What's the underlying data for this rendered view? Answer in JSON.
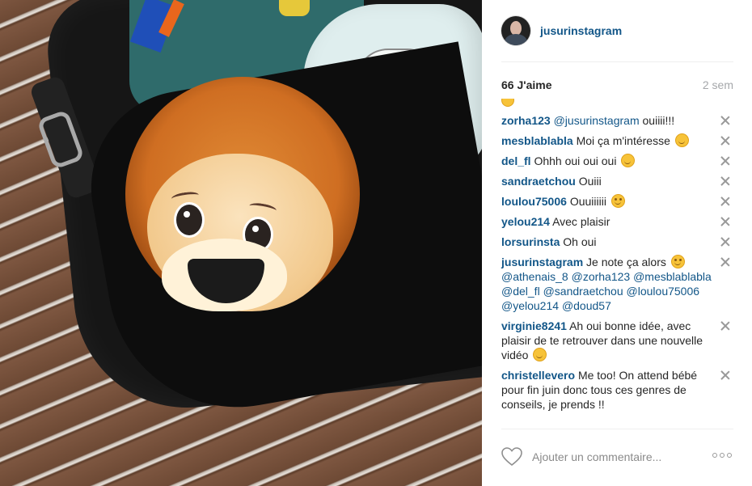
{
  "post": {
    "author": "jusurinstagram",
    "likes": "66 J'aime",
    "time": "2 sem"
  },
  "comments": [
    {
      "user": "zorha123",
      "text": "@jusurinstagram ouiiii!!!",
      "parts": [
        {
          "t": "mention",
          "v": "@jusurinstagram"
        },
        {
          "t": "text",
          "v": " ouiiii!!!"
        }
      ]
    },
    {
      "user": "mesblablabla",
      "parts": [
        {
          "t": "text",
          "v": "Moi ça m'intéresse "
        },
        {
          "t": "emoji",
          "v": "smile"
        }
      ]
    },
    {
      "user": "del_fl",
      "parts": [
        {
          "t": "text",
          "v": "Ohhh oui oui oui "
        },
        {
          "t": "emoji",
          "v": "grin"
        }
      ]
    },
    {
      "user": "sandraetchou",
      "parts": [
        {
          "t": "text",
          "v": "Ouiii"
        }
      ]
    },
    {
      "user": "loulou75006",
      "parts": [
        {
          "t": "text",
          "v": "Ouuiiiiii "
        },
        {
          "t": "emoji",
          "v": "wink"
        }
      ]
    },
    {
      "user": "yelou214",
      "parts": [
        {
          "t": "text",
          "v": "Avec plaisir"
        }
      ]
    },
    {
      "user": "lorsurinsta",
      "parts": [
        {
          "t": "text",
          "v": "Oh oui"
        }
      ]
    },
    {
      "user": "jusurinstagram",
      "parts": [
        {
          "t": "text",
          "v": "Je note ça alors "
        },
        {
          "t": "emoji",
          "v": "wink"
        },
        {
          "t": "text",
          "v": " "
        },
        {
          "t": "mention",
          "v": "@athenais_8"
        },
        {
          "t": "text",
          "v": " "
        },
        {
          "t": "mention",
          "v": "@zorha123"
        },
        {
          "t": "text",
          "v": " "
        },
        {
          "t": "mention",
          "v": "@mesblablabla"
        },
        {
          "t": "text",
          "v": " "
        },
        {
          "t": "mention",
          "v": "@del_fl"
        },
        {
          "t": "text",
          "v": " "
        },
        {
          "t": "mention",
          "v": "@sandraetchou"
        },
        {
          "t": "text",
          "v": " "
        },
        {
          "t": "mention",
          "v": "@loulou75006"
        },
        {
          "t": "text",
          "v": " "
        },
        {
          "t": "mention",
          "v": "@yelou214"
        },
        {
          "t": "text",
          "v": " "
        },
        {
          "t": "mention",
          "v": "@doud57"
        }
      ]
    },
    {
      "user": "virginie8241",
      "parts": [
        {
          "t": "text",
          "v": "Ah oui bonne idée, avec plaisir de te retrouver dans une nouvelle vidéo "
        },
        {
          "t": "emoji",
          "v": "smile"
        }
      ]
    },
    {
      "user": "christellevero",
      "parts": [
        {
          "t": "text",
          "v": "Me too! On attend bébé pour fin juin donc tous ces genres de conseils, je prends !!"
        }
      ]
    }
  ],
  "footer": {
    "comment_placeholder": "Ajouter un commentaire..."
  },
  "icons": {
    "like": "heart-icon",
    "more": "more-options-icon",
    "remove": "close-icon"
  },
  "colors": {
    "username": "#125688",
    "text": "#262626",
    "muted": "#a5a7aa"
  }
}
